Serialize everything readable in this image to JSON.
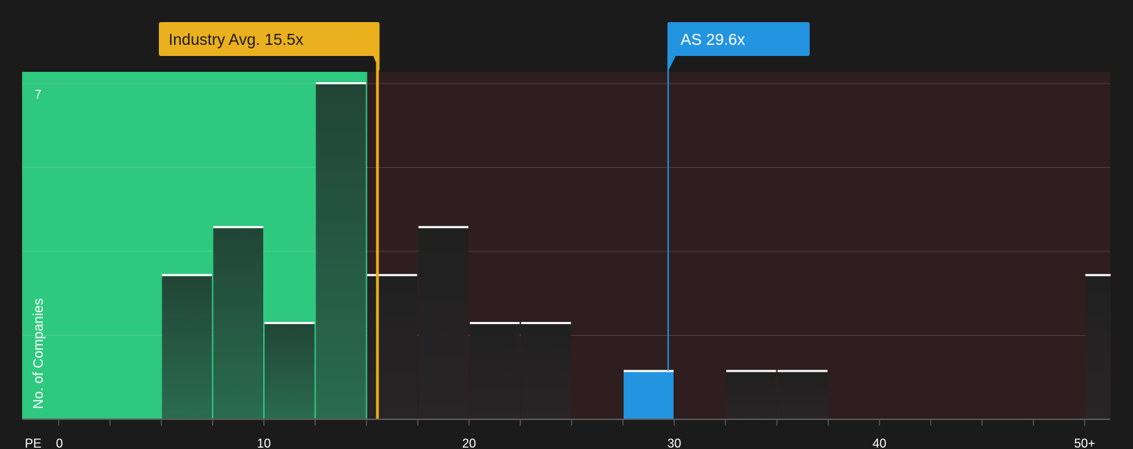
{
  "chart_data": {
    "type": "bar",
    "xlabel": "PE",
    "ylabel": "No. of Companies",
    "x_ticks": [
      "0",
      "10",
      "20",
      "30",
      "40",
      "50+"
    ],
    "y_tick_labels": [
      "7"
    ],
    "ylim": [
      0,
      7
    ],
    "xlim": [
      0,
      51.3
    ],
    "bin_width": 2.5,
    "bars": [
      {
        "x_start": 5,
        "x_end": 7.5,
        "value": 3,
        "highlight": false
      },
      {
        "x_start": 7.5,
        "x_end": 10,
        "value": 4,
        "highlight": false
      },
      {
        "x_start": 10,
        "x_end": 12.5,
        "value": 2,
        "highlight": false
      },
      {
        "x_start": 12.5,
        "x_end": 15,
        "value": 7,
        "highlight": false
      },
      {
        "x_start": 15,
        "x_end": 17.5,
        "value": 3,
        "highlight": false
      },
      {
        "x_start": 17.5,
        "x_end": 20,
        "value": 4,
        "highlight": false
      },
      {
        "x_start": 20,
        "x_end": 22.5,
        "value": 2,
        "highlight": false
      },
      {
        "x_start": 22.5,
        "x_end": 25,
        "value": 2,
        "highlight": false
      },
      {
        "x_start": 27.5,
        "x_end": 30,
        "value": 1,
        "highlight": true
      },
      {
        "x_start": 32.5,
        "x_end": 35,
        "value": 1,
        "highlight": false
      },
      {
        "x_start": 35,
        "x_end": 37.5,
        "value": 1,
        "highlight": false
      },
      {
        "x_start": 50,
        "x_end": 51.3,
        "value": 3,
        "highlight": false
      }
    ],
    "industry_avg": {
      "label": "Industry Avg. 15.5x",
      "value": 15.5
    },
    "company": {
      "label": "AS 29.6x",
      "value": 29.6
    },
    "colors": {
      "background": "#1b1b1b",
      "undervalued_region": "#2ec87e",
      "overvalued_region": "#2f1e1f",
      "bar": "#232323",
      "bar_in_green": "#244a38",
      "bar_top": "#ffffff",
      "company_bar": "#2394e0",
      "industry_callout": "#ebb01e",
      "company_callout": "#2394e0",
      "gridline": "#4a4a4a",
      "axis": "#5a5a5a",
      "text": "#ffffff",
      "industry_callout_text": "#1b1b1b"
    }
  }
}
